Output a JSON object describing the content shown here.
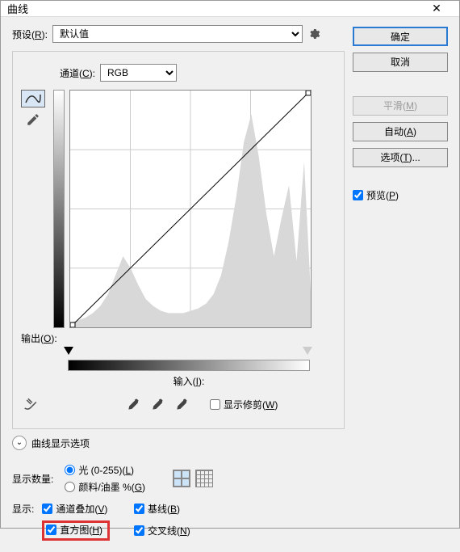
{
  "title": "曲线",
  "preset": {
    "label_text": "预设(",
    "label_key": "R",
    "value": "默认值"
  },
  "channel": {
    "label_text": "通道(",
    "label_key": "C",
    "value": "RGB"
  },
  "output_label_text": "输出(",
  "output_label_key": "O",
  "input_label_text": "输入(",
  "input_label_key": "I",
  "show_clip_text": "显示修剪(",
  "show_clip_key": "W",
  "expander_text": "曲线显示选项",
  "amount_label": "显示数量:",
  "amount_opts": {
    "light_text": "光 (0-255)(",
    "light_key": "L",
    "pigment_text": "颜料/油墨 %(",
    "pigment_key": "G"
  },
  "show_label": "显示:",
  "show_opts": {
    "overlay_text": "通道叠加(",
    "overlay_key": "V",
    "baseline_text": "基线(",
    "baseline_key": "B",
    "histogram_text": "直方图(",
    "histogram_key": "H",
    "cross_text": "交叉线(",
    "cross_key": "N"
  },
  "buttons": {
    "ok": "确定",
    "cancel": "取消",
    "smooth_text": "平滑(",
    "smooth_key": "M",
    "auto_text": "自动(",
    "auto_key": "A",
    "options_text": "选项(",
    "options_key": "T",
    "options_suffix": ")...",
    "preview_text": "预览(",
    "preview_key": "P"
  },
  "chart_data": {
    "type": "line",
    "title": "",
    "xlabel": "输入",
    "ylabel": "输出",
    "xlim": [
      0,
      255
    ],
    "ylim": [
      0,
      255
    ],
    "series": [
      {
        "name": "curve",
        "x": [
          0,
          255
        ],
        "y": [
          0,
          255
        ]
      }
    ],
    "histogram": {
      "bins_x": [
        0,
        8,
        16,
        24,
        32,
        40,
        48,
        56,
        64,
        72,
        80,
        88,
        96,
        104,
        112,
        120,
        128,
        136,
        144,
        152,
        160,
        168,
        176,
        184,
        192,
        200,
        208,
        216,
        224,
        232,
        240,
        248,
        255
      ],
      "heights_pct": [
        2,
        3,
        4,
        6,
        9,
        14,
        22,
        30,
        25,
        18,
        12,
        9,
        7,
        6,
        6,
        6,
        7,
        8,
        10,
        14,
        22,
        36,
        55,
        78,
        90,
        72,
        48,
        30,
        46,
        60,
        28,
        70,
        15
      ]
    }
  }
}
